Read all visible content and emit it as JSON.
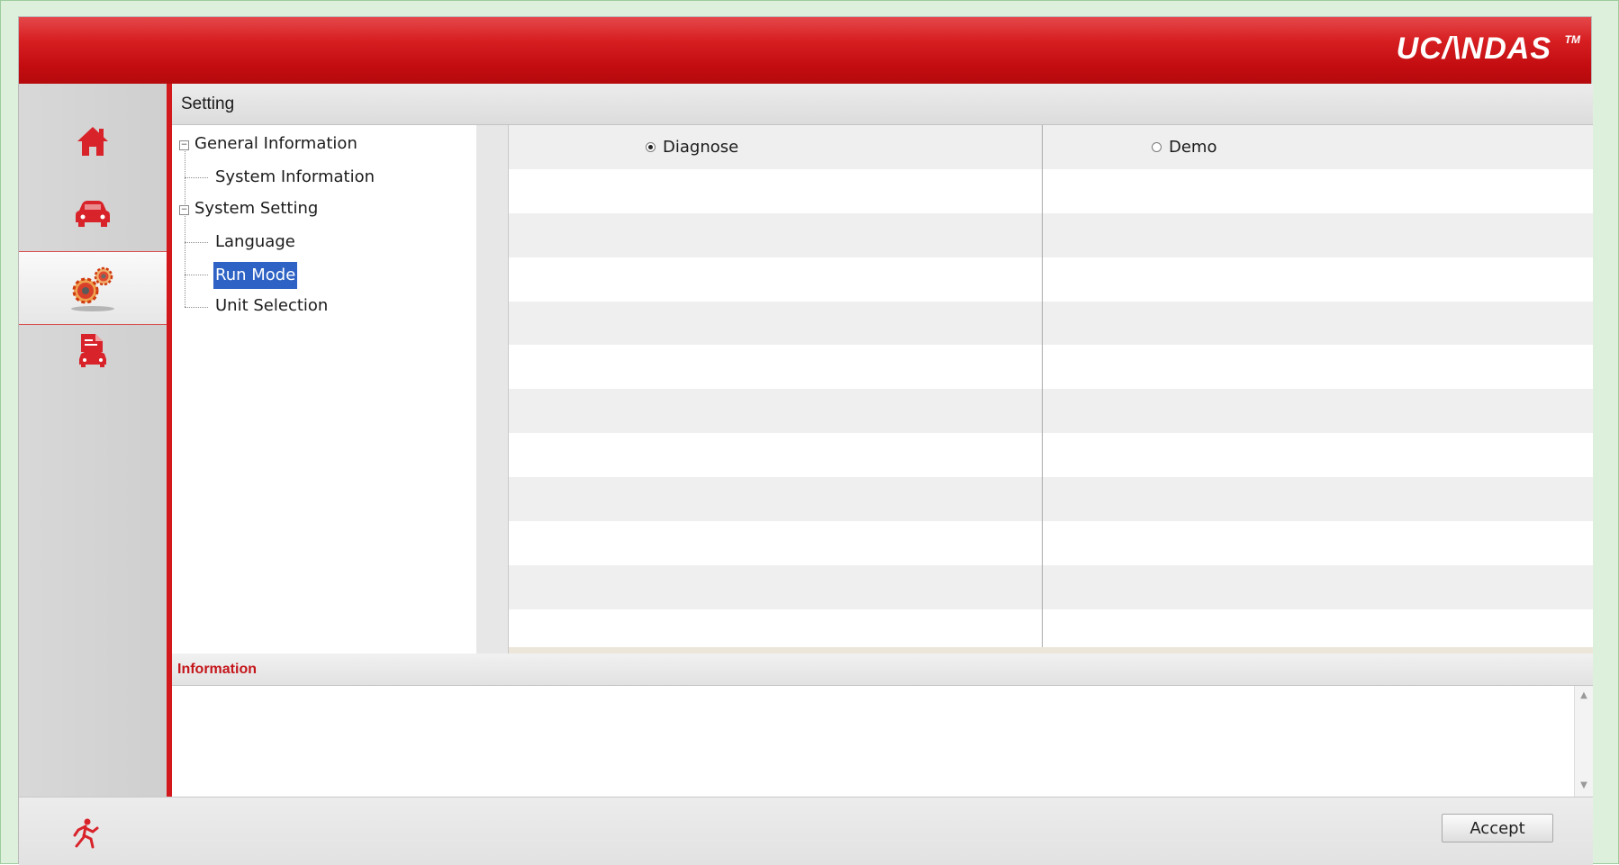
{
  "header": {
    "brand": "UC/\\NDAS",
    "brand_tm": "TM"
  },
  "sidebar": {
    "items": [
      {
        "name": "home",
        "icon": "home-icon",
        "active": false
      },
      {
        "name": "vehicle",
        "icon": "car-icon",
        "active": false
      },
      {
        "name": "settings",
        "icon": "gears-icon",
        "active": true
      },
      {
        "name": "report",
        "icon": "vehicle-report-icon",
        "active": false
      }
    ],
    "exit_icon": "running-man-exit-icon"
  },
  "page": {
    "title": "Setting"
  },
  "tree": {
    "groups": [
      {
        "label": "General Information",
        "children": [
          "System Information"
        ]
      },
      {
        "label": "System Setting",
        "children": [
          "Language",
          "Run Mode",
          "Unit Selection"
        ]
      }
    ],
    "selected": "Run Mode"
  },
  "run_mode": {
    "options": [
      {
        "label": "Diagnose",
        "checked": true
      },
      {
        "label": "Demo",
        "checked": false
      }
    ]
  },
  "info": {
    "title": "Information",
    "text": ""
  },
  "footer": {
    "accept_label": "Accept"
  },
  "colors": {
    "brand_red": "#c20c10",
    "accent_red": "#d2181d",
    "selection_blue": "#2e62c4"
  }
}
